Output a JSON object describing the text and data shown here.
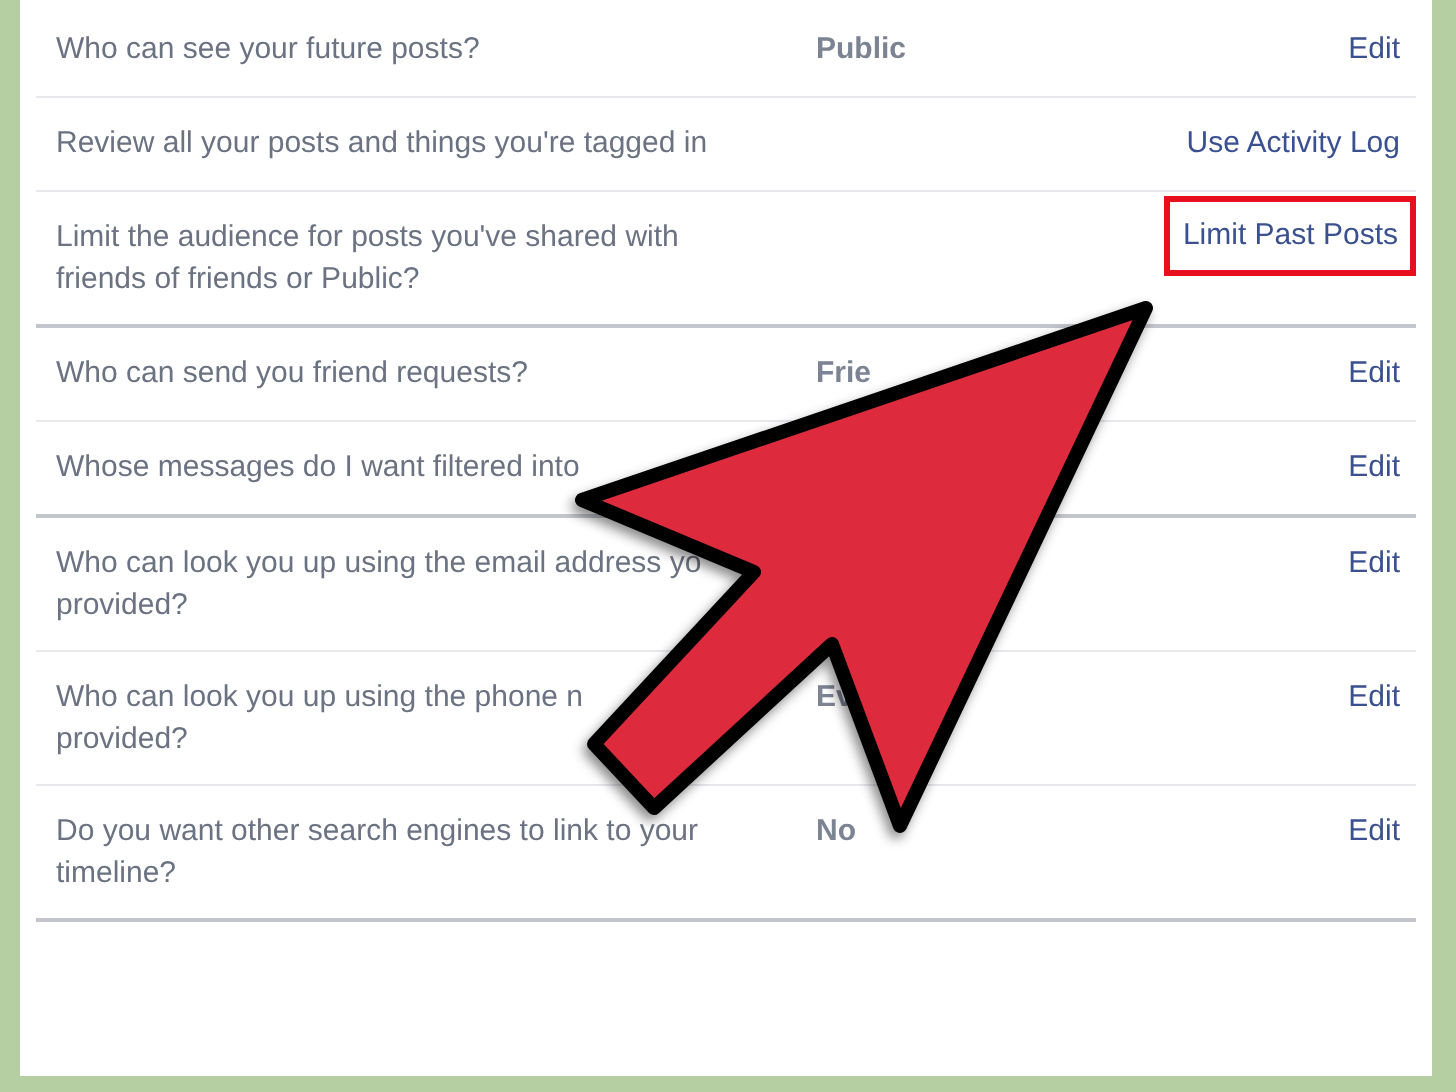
{
  "sections": [
    {
      "rows": [
        {
          "label": "Who can see your future posts?",
          "value": "Public",
          "action": {
            "text": "Edit",
            "highlighted": false
          }
        },
        {
          "label": "Review all your posts and things you're tagged in",
          "action": {
            "text": "Use Activity Log",
            "highlighted": false
          }
        },
        {
          "label": "Limit the audience for posts you've shared with friends of friends or Public?",
          "action": {
            "text": "Limit Past Posts",
            "highlighted": true
          }
        }
      ]
    },
    {
      "rows": [
        {
          "label": "Who can send you friend requests?",
          "value": "Frie",
          "action": {
            "text": "Edit",
            "highlighted": false
          }
        },
        {
          "label": "Whose messages do I want filtered into",
          "action": {
            "text": "Edit",
            "highlighted": false
          }
        }
      ]
    },
    {
      "rows": [
        {
          "label": "Who can look you up using the email address yo\nprovided?",
          "action": {
            "text": "Edit",
            "highlighted": false
          }
        },
        {
          "label": "Who can look you up using the phone n\nprovided?",
          "value": "Ev",
          "action": {
            "text": "Edit",
            "highlighted": false
          }
        },
        {
          "label": "Do you want other search engines to link to your timeline?",
          "value": "No",
          "action": {
            "text": "Edit",
            "highlighted": false
          }
        }
      ]
    }
  ]
}
